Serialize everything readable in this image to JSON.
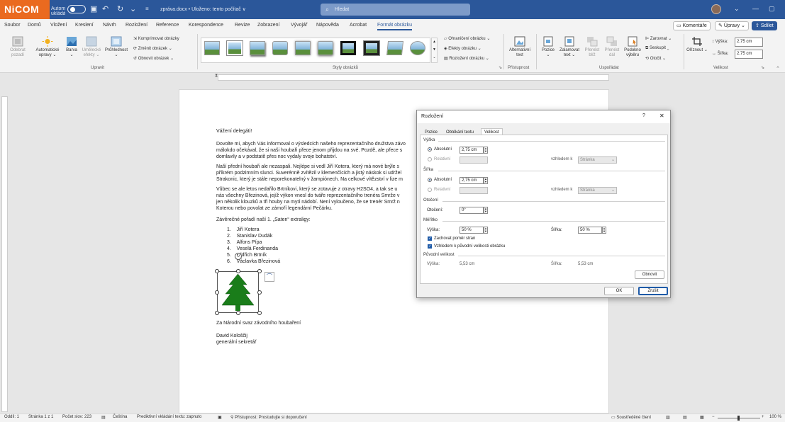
{
  "app": {
    "logo": "NiCOM",
    "autosave_label": "Automatické ukládání",
    "doc_title": "zpráva.docx • Uloženo: tento počítač ∨",
    "search_placeholder": "Hledat"
  },
  "menu": {
    "tabs": [
      "Soubor",
      "Domů",
      "Vložení",
      "Kreslení",
      "Návrh",
      "Rozložení",
      "Reference",
      "Korespondence",
      "Revize",
      "Zobrazení",
      "Vývojář",
      "Nápověda",
      "Acrobat",
      "Formát obrázku"
    ],
    "active_tab": "Formát obrázku",
    "comments": "Komentáře",
    "editing": "Úpravy",
    "share": "Sdílet"
  },
  "ribbon": {
    "remove_bg": "Odebrat pozadí",
    "artistic": "Automatické opravy",
    "color": "Barva",
    "artistic_effects": "Umělecké efekty",
    "transparency": "Průhlednost",
    "compress": "Komprimovat obrázky",
    "change": "Změnit obrázek",
    "reset": "Obnovit obrázek",
    "group_adjust": "Upravit",
    "group_styles": "Styly obrázků",
    "border": "Ohraničení obrázku",
    "effects": "Efekty obrázku",
    "layout": "Rozložení obrázku",
    "alt_text": "Alternativní text",
    "group_access": "Přístupnost",
    "position": "Pozice",
    "wrap": "Zalamovat text",
    "forward": "Přenést blíž",
    "backward": "Přenést dál",
    "selection": "Podokno výběru",
    "align": "Zarovnat",
    "group": "Seskupit",
    "rotate": "Otočit",
    "group_arrange": "Uspořádat",
    "crop": "Oříznout",
    "height_label": "Výška:",
    "height_value": "2,75 cm",
    "width_label": "Šířka:",
    "width_value": "2,75 cm",
    "group_size": "Velikost"
  },
  "document": {
    "greeting": "Vážení delegáti!",
    "p1a": "Dovolte mi, abych Vás informoval o výsledcích našeho reprezentačního družstva závo",
    "p1b": "málokdo očekával, že si naši houbaři přece jenom přijdou na své. Pozdě, ale přece s",
    "p1c": "domlavily a v podstatě přes noc vydaly svoje bohatství.",
    "p2a": "Naší přední houbaři ale nezaspali. Nejlépe si vedl Jiří Kotera, který má nové brýle s",
    "p2b": "příkrém podzimním slunci. Suverénně zvítězil v klemenčících a jistý náskok si udržel",
    "p2c": "Strakonic, který je stále neporekonatelný v žampiónech. Na celkové vítězství v lize m",
    "p3a": "Vůbec se ale letos nedařilo Brtníkovi, který se zotavuje z otravy H2SO4, a tak se u",
    "p3b": "nás všechny Březinová, jejíž výkon vnesl do tváře reprezentačního trenéra Smrže v",
    "p3c": "jen několik klouzků a tři houby na mytí nádobí. Není vyloučeno, že se trenér Smrž n",
    "p3d": "Koterou nebo povolat ze zámoří legendární Pečárku.",
    "ranking_title": "Závěrečné pořadí naší 1. „Saten“ extraligy:",
    "ranking": [
      "Jiří Kotera",
      "Stanislav Dudák",
      "Alfons Pípa",
      "Veselá Ferdinanda",
      "Oldřich Brtník",
      "Václavka Březinová"
    ],
    "sign1": "Za Národní svaz závodního houbaření",
    "sign2": "David Kološčij",
    "sign3": "generální sekretář"
  },
  "status": {
    "section": "Oddíl: 1",
    "page": "Stránka 1 z 1",
    "words": "Počet slov: 223",
    "lang": "Čeština",
    "predict": "Prediktivní vkládání textu: zapnuto",
    "access": "Přístupnost: Prostudujte si doporučení",
    "focus": "Soustředěné čtení",
    "zoom": "100 %"
  },
  "dialog": {
    "title": "Rozložení",
    "help": "?",
    "close": "✕",
    "tabs": [
      "Pozice",
      "Obtékání textu",
      "Velikost"
    ],
    "active_tab": "Velikost",
    "height_section": "Výška",
    "absolute": "Absolutní",
    "relative": "Relativní",
    "height_abs": "2,75 cm",
    "relative_to": "vzhledem k",
    "page_opt": "Stránka",
    "width_section": "Šířka",
    "width_abs": "2,75 cm",
    "rotation_section": "Otočení",
    "rotation_label": "Otočení:",
    "rotation_value": "0°",
    "scale_section": "Měřítko",
    "scale_height_label": "Výška:",
    "scale_height": "50 %",
    "scale_width_label": "Šířka:",
    "scale_width": "50 %",
    "lock_ratio": "Zachovat poměr stran",
    "relative_orig": "Vzhledem k původní velikosti obrázku",
    "original_section": "Původní velikost",
    "orig_height_label": "Výška:",
    "orig_height": "5,53 cm",
    "orig_width_label": "Šířka:",
    "orig_width": "5,53 cm",
    "reset": "Obnovit",
    "ok": "OK",
    "cancel": "Zrušit"
  },
  "colors": {
    "accent": "#2b579a",
    "logo": "#ea6a1f",
    "tree": "#1a7d1a"
  }
}
